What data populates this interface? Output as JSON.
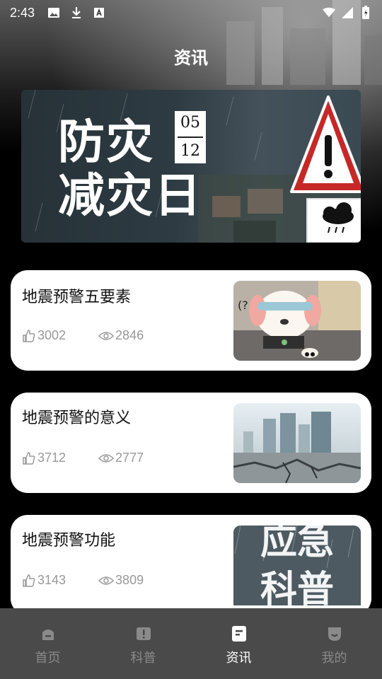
{
  "status": {
    "time": "2:43",
    "left_icons": [
      "image-icon",
      "download-icon",
      "font-a-icon"
    ],
    "right_icons": [
      "wifi-icon",
      "signal-icon",
      "battery-icon"
    ]
  },
  "header": {
    "title": "资讯"
  },
  "banner": {
    "text_line1": "防灾",
    "text_line2": "减灾日",
    "date_month": "05",
    "date_day": "12"
  },
  "articles": [
    {
      "title": "地震预警五要素",
      "likes": "3002",
      "views": "2846"
    },
    {
      "title": "地震预警的意义",
      "likes": "3712",
      "views": "2777"
    },
    {
      "title": "地震预警功能",
      "likes": "3143",
      "views": "3809"
    }
  ],
  "thumb3_text": {
    "line1": "应急",
    "line2": "科普"
  },
  "tabs": [
    {
      "label": "首页",
      "icon": "home-icon",
      "active": false
    },
    {
      "label": "科普",
      "icon": "alert-book-icon",
      "active": false
    },
    {
      "label": "资讯",
      "icon": "news-icon",
      "active": true
    },
    {
      "label": "我的",
      "icon": "profile-icon",
      "active": false
    }
  ],
  "colors": {
    "tabbar_bg": "#4a4a4a",
    "tab_active": "#ffffff",
    "tab_inactive": "#8a8a8a",
    "card_bg": "#ffffff",
    "stat_text": "#999999"
  }
}
